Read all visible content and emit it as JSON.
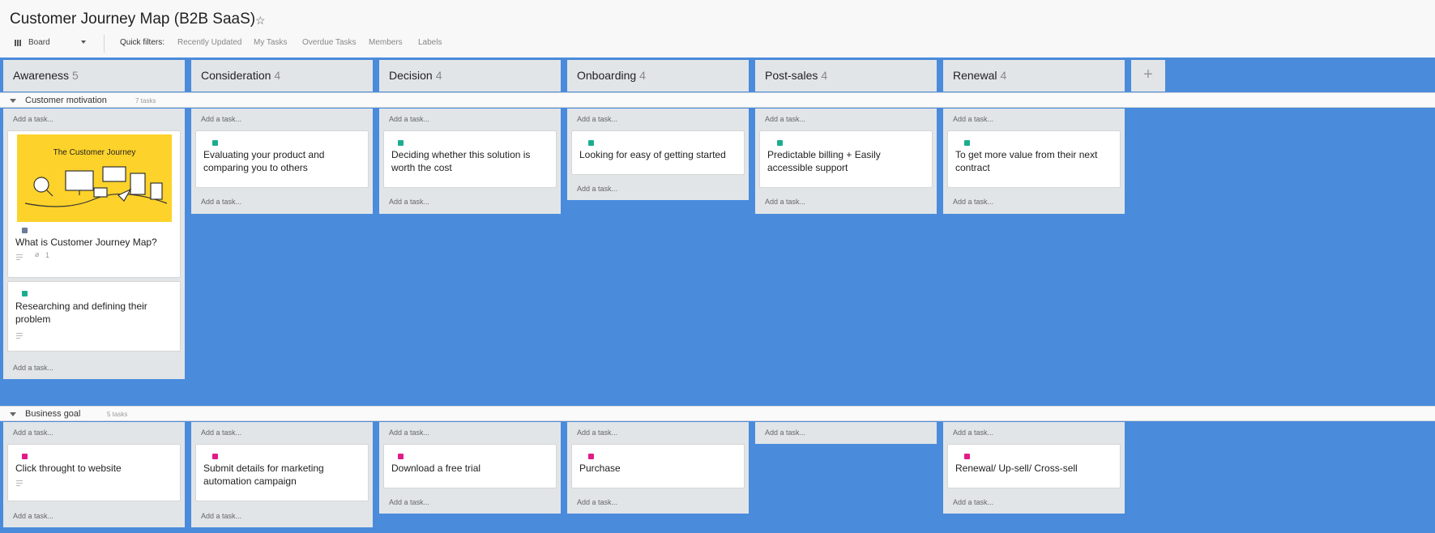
{
  "board": {
    "title": "Customer Journey Map (B2B SaaS)",
    "star_icon": "star-outline-icon",
    "view": "Board",
    "quick_filters_label": "Quick filters:",
    "filters": [
      "Recently Updated",
      "My Tasks",
      "Overdue Tasks",
      "Members",
      "Labels"
    ],
    "add_column_label": "+"
  },
  "columns": [
    {
      "name": "Awareness",
      "count": "5"
    },
    {
      "name": "Consideration",
      "count": "4"
    },
    {
      "name": "Decision",
      "count": "4"
    },
    {
      "name": "Onboarding",
      "count": "4"
    },
    {
      "name": "Post-sales",
      "count": "4"
    },
    {
      "name": "Renewal",
      "count": "4"
    }
  ],
  "add_task_label": "Add a task...",
  "lanes": [
    {
      "name": "Customer motivation",
      "count": "7 tasks",
      "cards": {
        "awareness": [
          {
            "cover_text": "The Customer Journey",
            "text": "What is Customer Journey Map?",
            "label_color": "#6b7a99",
            "attachments": "1"
          },
          {
            "text": "Researching and defining their problem",
            "label_color": "#1aae8f"
          }
        ],
        "consideration": {
          "text": "Evaluating your product and comparing you to others",
          "label_color": "#1aae8f"
        },
        "decision": {
          "text": "Deciding whether this solution is worth the cost",
          "label_color": "#1aae8f"
        },
        "onboarding": {
          "text": "Looking for easy of getting started",
          "label_color": "#1aae8f"
        },
        "post_sales": {
          "text": "Predictable billing + Easily accessible support",
          "label_color": "#1aae8f"
        },
        "renewal": {
          "text": "To get more value from their next contract",
          "label_color": "#1aae8f"
        }
      }
    },
    {
      "name": "Business goal",
      "count": "5 tasks",
      "cards": {
        "awareness": {
          "text": "Click throught to website",
          "label_color": "#e01c8a"
        },
        "consideration": {
          "text": "Submit details for marketing automation campaign",
          "label_color": "#e01c8a"
        },
        "decision": {
          "text": "Download a free trial",
          "label_color": "#e01c8a"
        },
        "onboarding": {
          "text": "Purchase",
          "label_color": "#e01c8a"
        },
        "renewal": {
          "text": "Renewal/ Up-sell/ Cross-sell",
          "label_color": "#e01c8a"
        }
      }
    }
  ],
  "colors": {
    "board_background": "#4a8bdc",
    "column_background": "#e1e5e8",
    "header_background": "#f8f8f8",
    "cover_background": "#fdd22a"
  }
}
